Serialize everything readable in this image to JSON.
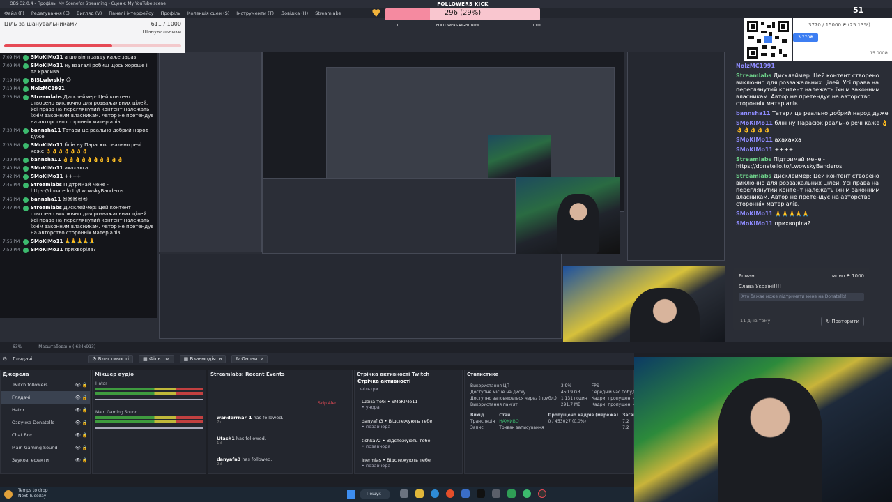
{
  "window": {
    "title": "OBS 32.0.4 - Профіль: My Scenefor Streaming - Сцени: My YouTube scene"
  },
  "menu": [
    "Файл (F)",
    "Редагування (Е)",
    "Вигляд (V)",
    "Панелі інтерфейсу",
    "Профіль",
    "Колекція сцен (S)",
    "Інструменти (T)",
    "Довідка (H)",
    "Streamlabs"
  ],
  "goal": {
    "title": "Ціль за шанувальниками",
    "count": "611 / 1000",
    "subtitle": "Шанувальники",
    "progress": 0.611
  },
  "kick": {
    "title": "FOLLOWERS KICK",
    "value": "296 (29%)",
    "progress": 0.29,
    "left": "0",
    "right": "1000",
    "label": "FOLLOWERS RIGHT NOW"
  },
  "donation": {
    "text": "3770 / 15000 ₴ (25.13%)",
    "badge": "3 770₴",
    "left": "Lorem",
    "right": "15 000₴",
    "progress": 0.2513
  },
  "viewer_count": "51",
  "left_chat": [
    {
      "time": "7:09 PM",
      "user": "SMoKIMo11",
      "color": "#ffffff",
      "text": "а шо він правду каже зараз"
    },
    {
      "time": "7:09 PM",
      "user": "SMoKIMo11",
      "color": "#ffffff",
      "text": "ну взагалі робиш щось хороше і та красива"
    },
    {
      "time": "7:19 PM",
      "user": "BISLwlwskly",
      "color": "#ffffff",
      "text": "😊"
    },
    {
      "time": "7:19 PM",
      "user": "NoIzMC1991",
      "color": "#ffffff",
      "text": ""
    },
    {
      "time": "7:23 PM",
      "user": "Streamlabs",
      "color": "#ffffff",
      "text": "Дисклеймер: Цей контент створено виключно для розважальних цілей. Усі права на переглянутий контент належать їхнім законним власникам. Автор не претендує на авторство сторонніх матеріалів."
    },
    {
      "time": "7:30 PM",
      "user": "bannsha11",
      "color": "#ffffff",
      "text": "Татари це реально добрий народ дуже"
    },
    {
      "time": "7:33 PM",
      "user": "SMoKIMo11",
      "color": "#ffffff",
      "text": "блін ну Парасюк реально речі каже 👌👌👌👌👌👌👌"
    },
    {
      "time": "7:39 PM",
      "user": "bannsha11",
      "color": "#ffffff",
      "text": "👌👌👌👌👌👌👌👌👌👌"
    },
    {
      "time": "7:40 PM",
      "user": "SMoKIMo11",
      "color": "#ffffff",
      "text": "ахахахха"
    },
    {
      "time": "7:42 PM",
      "user": "SMoKIMo11",
      "color": "#ffffff",
      "text": "++++"
    },
    {
      "time": "7:45 PM",
      "user": "Streamlabs",
      "color": "#ffffff",
      "text": "Підтримай мене - https://donatello.to/LwowskyBanderos"
    },
    {
      "time": "7:46 PM",
      "user": "bannsha11",
      "color": "#ffffff",
      "text": "😍😍😍😍😍"
    },
    {
      "time": "7:47 PM",
      "user": "Streamlabs",
      "color": "#ffffff",
      "text": "Дисклеймер: Цей контент створено виключно для розважальних цілей. Усі права на переглянутий контент належать їхнім законним власникам. Автор не претендує на авторство сторонніх матеріалів."
    },
    {
      "time": "7:56 PM",
      "user": "SMoKIMo11",
      "color": "#ffffff",
      "text": "🙏🙏🙏🙏🙏"
    },
    {
      "time": "7:59 PM",
      "user": "SMoKIMo11",
      "color": "#ffffff",
      "text": "прихворіла?"
    }
  ],
  "right_chat": [
    {
      "user": "NoIzMC1991",
      "text": ""
    },
    {
      "user": "Streamlabs",
      "text": "Дисклеймер: Цей контент створено виключно для розважальних цілей. Усі права на переглянутий контент належать їхнім законним власникам. Автор не претендує на авторство сторонніх матеріалів."
    },
    {
      "user": "bannsha11",
      "text": "Татари це реально добрий народ дуже"
    },
    {
      "user": "SMoKIMo11",
      "text": "блін ну Парасюк реально речі каже 👌👌👌👌👌👌"
    },
    {
      "user": "SMoKIMo11",
      "text": "ахахахха"
    },
    {
      "user": "SMoKIMo11",
      "text": "++++"
    },
    {
      "user": "Streamlabs",
      "text": "Підтримай мене - https://donatello.to/LwowskyBanderos"
    },
    {
      "user": "Streamlabs",
      "text": "Дисклеймер: Цей контент створено виключно для розважальних цілей. Усі права на переглянутий контент належать їхнім законним власникам. Автор не претендує на авторство сторонніх матеріалів."
    },
    {
      "user": "SMoKIMo11",
      "text": "🙏🙏🙏🙏🙏"
    },
    {
      "user": "SMoKIMo11",
      "text": "прихворіла?"
    }
  ],
  "donation_card": {
    "name": "Роман",
    "amount": "моно ₴ 1000",
    "message": "Слава Україні!!!!",
    "prompt": "Хто бажає може підтримати мене на Donatello!",
    "date": "11 днів тому",
    "repeat": "Повторити"
  },
  "zoom": {
    "text": "63%",
    "scale": "Масштабовано ( 624x913)"
  },
  "toolbar": {
    "scene": "Глядачі",
    "props": "Властивості",
    "filters": "Фільтри",
    "transform": "Взаємодіяти",
    "refresh": "Оновити"
  },
  "sources": {
    "title": "Джерела",
    "items": [
      "Twitch followers",
      "Глядачі",
      "Hator",
      "Озвучка Donatello",
      "Chat Box",
      "Main Gaming Sound",
      "Звукові ефекти"
    ]
  },
  "mixer": {
    "title": "Мікшер аудіо",
    "channels": [
      "Hator",
      "Main Gaming Sound"
    ]
  },
  "events": {
    "title": "Streamlabs: Recent Events",
    "skip": "Skip Alert",
    "items": [
      {
        "user": "wanderrnar_1",
        "text": "has followed.",
        "time": "7s"
      },
      {
        "user": "Utach1",
        "text": "has followed.",
        "time": "1d"
      },
      {
        "user": "danyafn3",
        "text": "has followed.",
        "time": "2d"
      }
    ]
  },
  "activity": {
    "title": "Стрічка активності Twitch",
    "subtitle": "Стрічка активності",
    "filter": "Фільтри",
    "items": [
      {
        "text": "Шана тобі • SMoKIMo11",
        "sub": "• учора"
      },
      {
        "text": "danyafn3 • Відстежують тебе",
        "sub": "• позавчора"
      },
      {
        "text": "tishka72 • Відстежують тебе",
        "sub": "• позавчора"
      },
      {
        "text": "Inermias • Відстежують тебе",
        "sub": "• позавчора"
      }
    ]
  },
  "stats": {
    "title": "Статистика",
    "rows": [
      [
        "Використання ЦП",
        "3.9%",
        "FPS",
        ""
      ],
      [
        "Доступне місце на диску",
        "450.9 GB",
        "Середній час побудови кадру",
        ""
      ],
      [
        "Доступно заповнюється через (прибл.)",
        "1 131 годин",
        "Кадри, пропущені через",
        ""
      ],
      [
        "Використання пам'яті",
        "291.7 MB",
        "Кадри, пропущені через",
        ""
      ]
    ],
    "out_head": [
      "Вихід",
      "Стан",
      "Пропущено кадрів (мережа)",
      "Загал"
    ],
    "out_rows": [
      [
        "Трансляція",
        "НАЖИВО",
        "0 / 453027 (0.0%)",
        "7.2"
      ],
      [
        "Запис",
        "Тривак записування",
        "",
        "7.2"
      ]
    ]
  },
  "taskbar": {
    "weather1": "Temps to drop",
    "weather2": "Next Tuesday",
    "search": "Пошук"
  },
  "colors": {
    "accent": "#3d7ef2",
    "live": "#3cba6e",
    "alert": "#e64a55"
  }
}
